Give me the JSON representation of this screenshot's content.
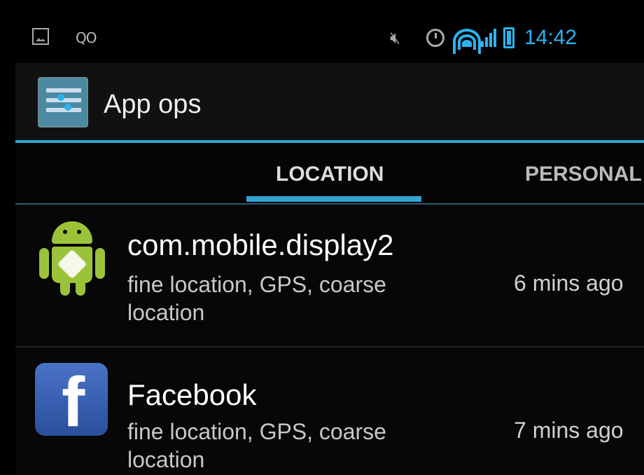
{
  "status_bar": {
    "left_icons": [
      "image-icon",
      "voicemail-icon"
    ],
    "voicemail_glyph": "QO",
    "right_icons": [
      "mute-icon",
      "alarm-icon",
      "wifi-icon",
      "signal-icon",
      "battery-icon"
    ],
    "time": "14:42",
    "accent_color": "#2bb3f0"
  },
  "action_bar": {
    "icon": "app-ops-icon",
    "title": "App ops"
  },
  "tabs": [
    {
      "label": "LOCATION",
      "selected": true
    },
    {
      "label": "PERSONAL",
      "selected": false
    }
  ],
  "apps": [
    {
      "name": "com.mobile.display2",
      "icon": "android-icon",
      "permissions": "fine location, GPS, coarse location",
      "time": "6 mins ago"
    },
    {
      "name": "Facebook",
      "icon": "facebook-icon",
      "permissions": "fine location, GPS, coarse location",
      "time": "7 mins ago"
    }
  ]
}
